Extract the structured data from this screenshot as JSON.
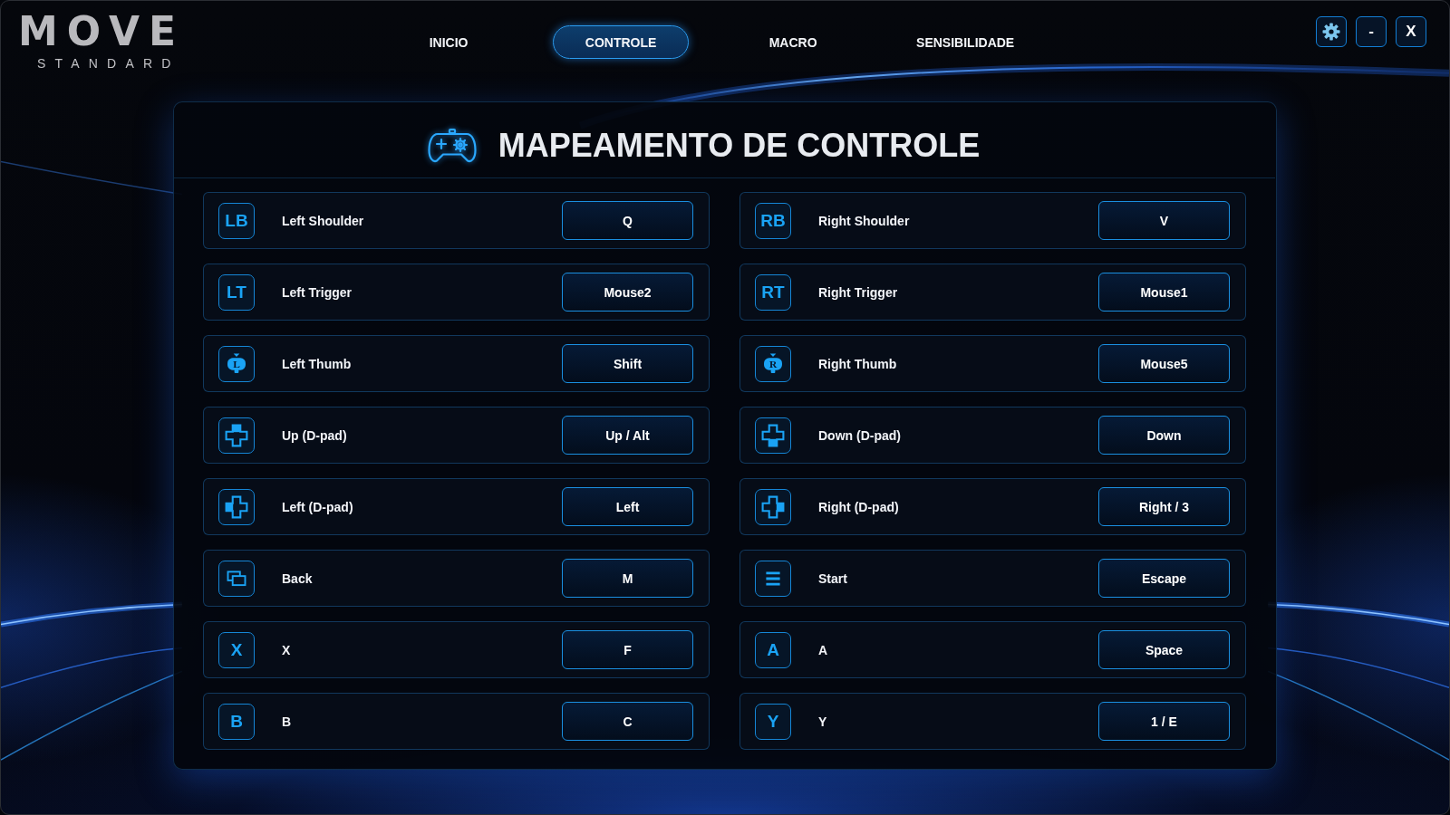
{
  "logo": {
    "wordmark": "MOVE",
    "tagline": "STANDARD"
  },
  "tabs": [
    {
      "label": "INICIO",
      "selected": false
    },
    {
      "label": "CONTROLE",
      "selected": true
    },
    {
      "label": "MACRO",
      "selected": false
    },
    {
      "label": "SENSIBILIDADE",
      "selected": false
    }
  ],
  "window_controls": [
    {
      "kind": "settings"
    },
    {
      "kind": "minimize",
      "label": "-"
    },
    {
      "kind": "close",
      "label": "X"
    }
  ],
  "panel": {
    "title": "MAPEAMENTO DE CONTROLE",
    "bindings": [
      {
        "icon": {
          "kind": "letters",
          "label": "LB"
        },
        "name": "Left Shoulder",
        "key": "Q"
      },
      {
        "icon": {
          "kind": "letters",
          "label": "RB"
        },
        "name": "Right Shoulder",
        "key": "V"
      },
      {
        "icon": {
          "kind": "letters",
          "label": "LT"
        },
        "name": "Left Trigger",
        "key": "Mouse2"
      },
      {
        "icon": {
          "kind": "letters",
          "label": "RT"
        },
        "name": "Right Trigger",
        "key": "Mouse1"
      },
      {
        "icon": {
          "kind": "thumb",
          "label": "L"
        },
        "name": "Left Thumb",
        "key": "Shift"
      },
      {
        "icon": {
          "kind": "thumb",
          "label": "R"
        },
        "name": "Right Thumb",
        "key": "Mouse5"
      },
      {
        "icon": {
          "kind": "dpad",
          "up": true,
          "down": false,
          "left": false,
          "right": false
        },
        "name": "Up (D-pad)",
        "key": "Up / Alt"
      },
      {
        "icon": {
          "kind": "dpad",
          "up": false,
          "down": true,
          "left": false,
          "right": false
        },
        "name": "Down (D-pad)",
        "key": "Down"
      },
      {
        "icon": {
          "kind": "dpad",
          "up": false,
          "down": false,
          "left": true,
          "right": false
        },
        "name": "Left (D-pad)",
        "key": "Left"
      },
      {
        "icon": {
          "kind": "dpad",
          "up": false,
          "down": false,
          "left": false,
          "right": true
        },
        "name": "Right (D-pad)",
        "key": "Right / 3"
      },
      {
        "icon": {
          "kind": "back"
        },
        "name": "Back",
        "key": "M"
      },
      {
        "icon": {
          "kind": "menu"
        },
        "name": "Start",
        "key": "Escape"
      },
      {
        "icon": {
          "kind": "letters",
          "label": "X"
        },
        "name": "X",
        "key": "F"
      },
      {
        "icon": {
          "kind": "letters",
          "label": "A"
        },
        "name": "A",
        "key": "Space"
      },
      {
        "icon": {
          "kind": "letters",
          "label": "B"
        },
        "name": "B",
        "key": "C"
      },
      {
        "icon": {
          "kind": "letters",
          "label": "Y"
        },
        "name": "Y",
        "key": "1 / E"
      }
    ]
  }
}
